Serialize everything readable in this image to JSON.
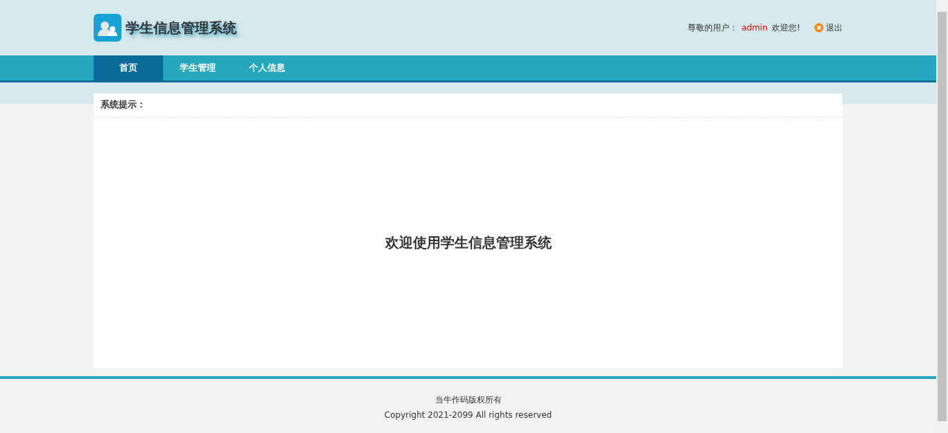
{
  "header": {
    "title": "学生信息管理系统",
    "greeting": "尊敬的用户：",
    "username": "admin",
    "welcome": "欢迎您!",
    "logout": "退出"
  },
  "nav": [
    {
      "label": "首页",
      "selected": true
    },
    {
      "label": "学生管理",
      "selected": false
    },
    {
      "label": "个人信息",
      "selected": false
    }
  ],
  "panel": {
    "title": "系统提示：",
    "message": "欢迎使用学生信息管理系统"
  },
  "footer": {
    "lines": [
      "当牛作码版权所有",
      "Copyright 2021-2099 All rights reserved"
    ]
  }
}
